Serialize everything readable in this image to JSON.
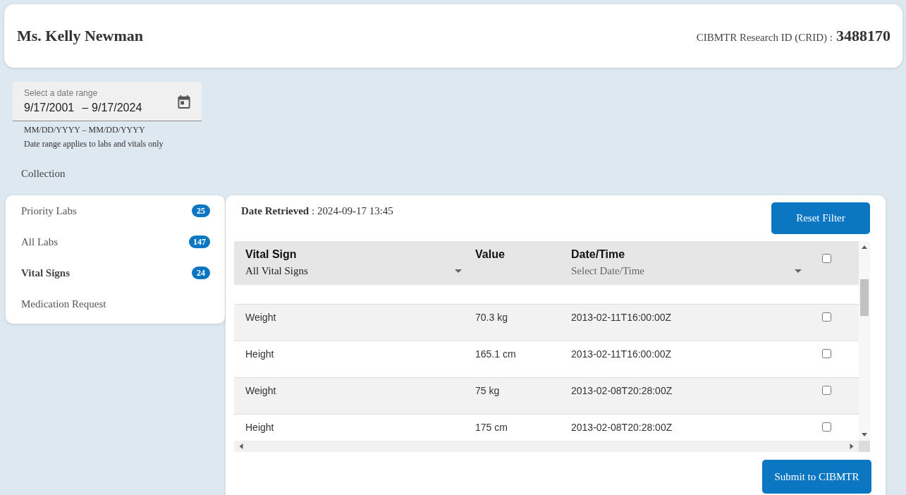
{
  "header": {
    "patient_name": "Ms. Kelly Newman",
    "id_label": "CIBMTR Research ID (CRID) :",
    "id_value": "3488170"
  },
  "date_range": {
    "label": "Select a date range",
    "start": "9/17/2001",
    "separator": "–",
    "end": "9/17/2024",
    "format_hint": "MM/DD/YYYY – MM/DD/YYYY",
    "note": "Date range applies to labs and vitals only"
  },
  "section_title": "Collection",
  "sidebar": {
    "items": [
      {
        "label": "Priority Labs",
        "count": "25",
        "selected": false
      },
      {
        "label": "All Labs",
        "count": "147",
        "selected": false
      },
      {
        "label": "Vital Signs",
        "count": "24",
        "selected": true
      },
      {
        "label": "Medication Request",
        "selected": false
      }
    ]
  },
  "panel": {
    "retrieved": "**Date Retrieved** : 2024-09-17 13:45",
    "reset_button": "Reset Filter",
    "submit_button": "Submit to CIBMTR"
  },
  "table": {
    "columns": [
      {
        "kind": "filter",
        "title": "Vital Sign",
        "filter": {
          "value": "All Vital Signs"
        }
      },
      {
        "kind": "plain",
        "title": "Value"
      },
      {
        "kind": "filter",
        "title": "Date/Time",
        "filter": {
          "placeholder": "Select Date/Time"
        }
      },
      {
        "kind": "select_all",
        "checked": false
      }
    ],
    "rows": [
      {
        "vital_sign": "Weight",
        "value": "70.3 kg",
        "date_time": "2013-02-11T16:00:00Z",
        "checked": false
      },
      {
        "vital_sign": "Height",
        "value": "165.1 cm",
        "date_time": "2013-02-11T16:00:00Z",
        "checked": false
      },
      {
        "vital_sign": "Weight",
        "value": "75 kg",
        "date_time": "2013-02-08T20:28:00Z",
        "checked": false
      },
      {
        "vital_sign": "Height",
        "value": "175 cm",
        "date_time": "2013-02-08T20:28:00Z",
        "checked": false
      }
    ]
  }
}
